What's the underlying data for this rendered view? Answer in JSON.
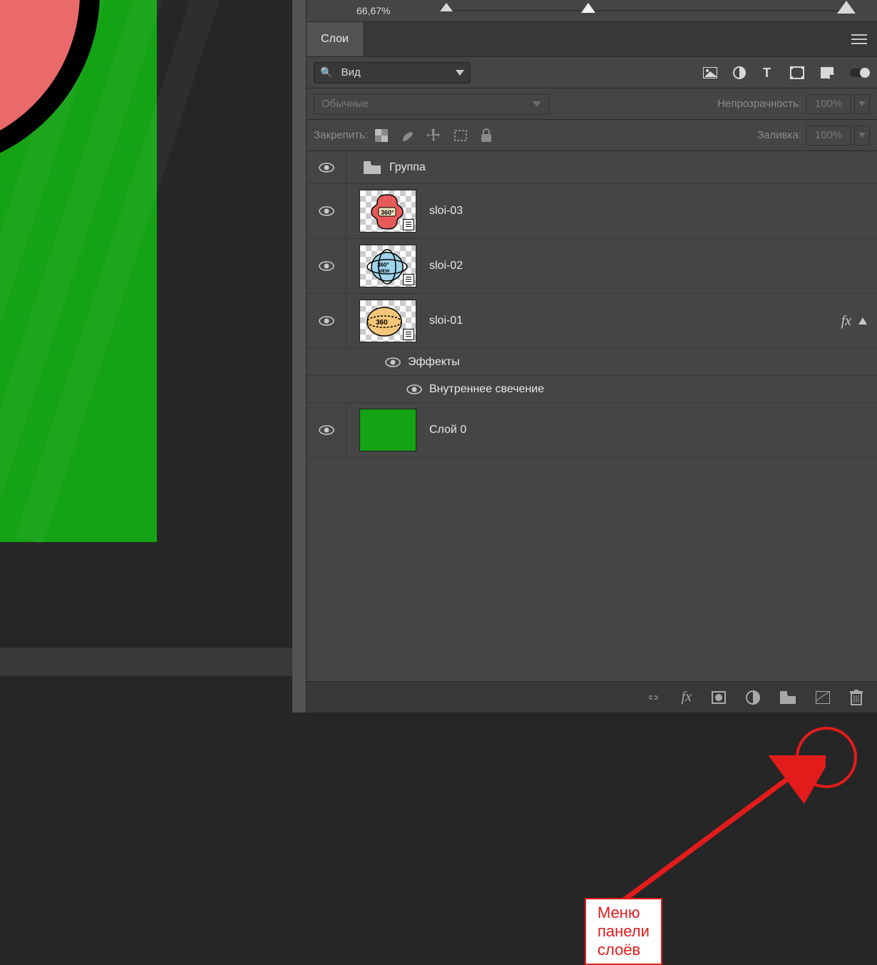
{
  "zoom": {
    "value": "66,67%"
  },
  "tabs": {
    "layers": "Слои"
  },
  "search": {
    "placeholder": "Вид"
  },
  "blend": {
    "mode": "Обычные",
    "opacity_label": "Непрозрачность:",
    "opacity_value": "100%"
  },
  "lock": {
    "label": "Закрепить:",
    "fill_label": "Заливка:",
    "fill_value": "100%"
  },
  "group": {
    "name": "Группа"
  },
  "layers": [
    {
      "name": "sloi-03"
    },
    {
      "name": "sloi-02"
    },
    {
      "name": "sloi-01"
    },
    {
      "name": "Слой 0"
    }
  ],
  "effects": {
    "heading": "Эффекты",
    "item": "Внутреннее свечение"
  },
  "fx": {
    "label": "fx"
  },
  "annotation": {
    "label": "Меню панели слоёв"
  }
}
